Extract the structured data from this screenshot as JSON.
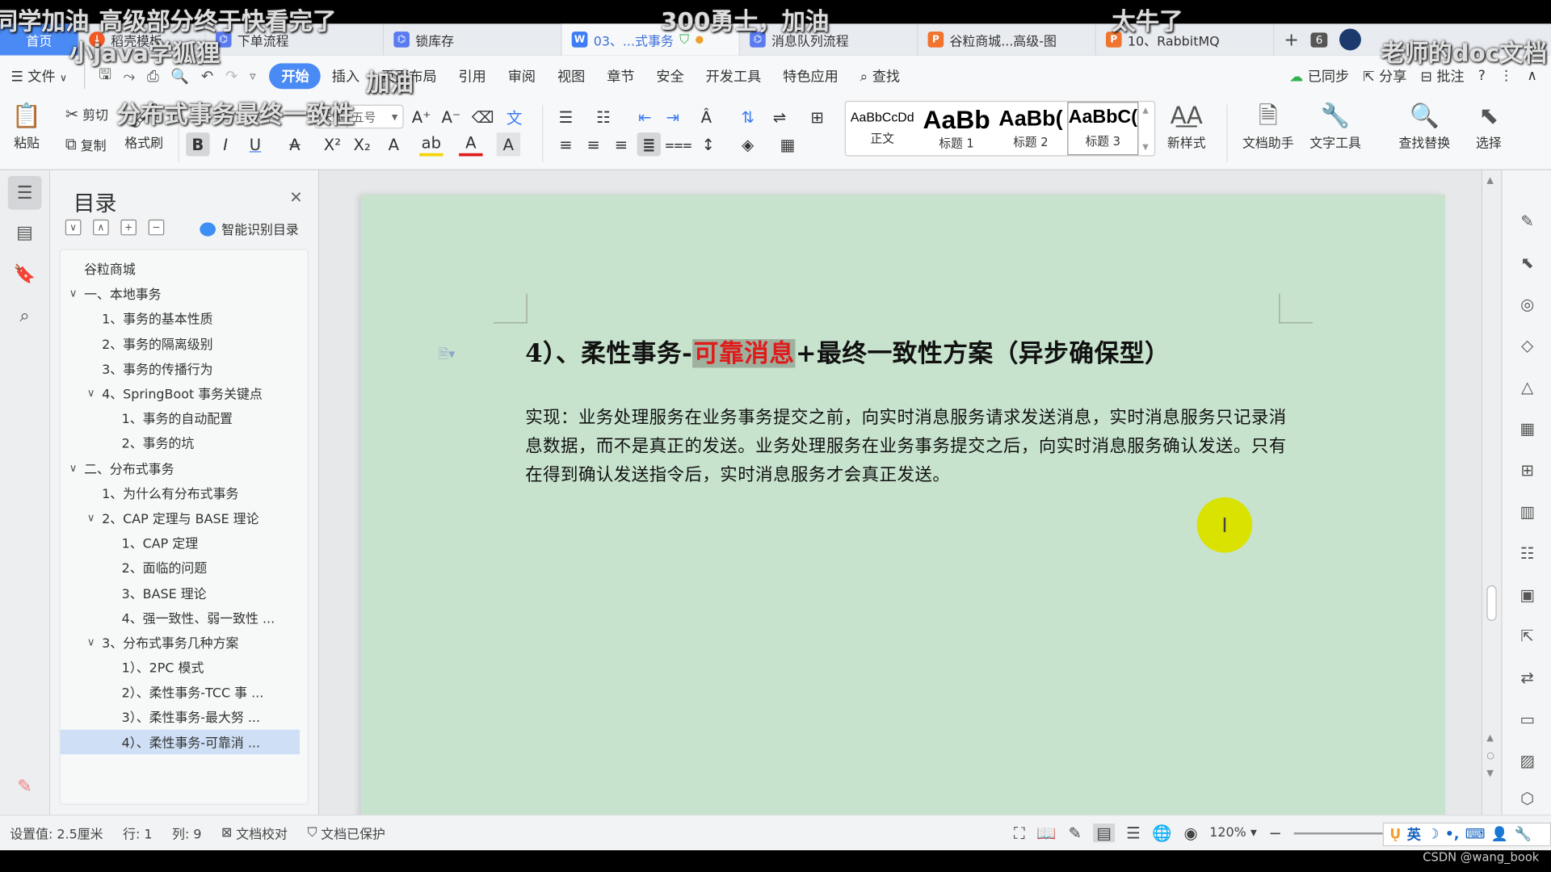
{
  "tabs": [
    {
      "label": "首页",
      "icon": "home",
      "kind": "home"
    },
    {
      "label": "稻壳模板",
      "icon": "daoke-icon",
      "kind": "daoke"
    },
    {
      "label": "下单流程",
      "icon": "flowchart-icon",
      "kind": "flow"
    },
    {
      "label": "锁库存",
      "icon": "flowchart-icon",
      "kind": "flow"
    },
    {
      "label": "03、...式事务",
      "icon": "word-doc-icon",
      "kind": "word",
      "active": true,
      "status": "●"
    },
    {
      "label": "消息队列流程",
      "icon": "flowchart-icon",
      "kind": "flow"
    },
    {
      "label": "谷粒商城...高级-图",
      "icon": "ppt-icon",
      "kind": "ppt"
    },
    {
      "label": "10、RabbitMQ",
      "icon": "ppt-icon",
      "kind": "ppt"
    }
  ],
  "tab_extras": {
    "new_tab": "+",
    "tab_count": "6"
  },
  "menu": {
    "file": "文件",
    "items": [
      "开始",
      "插入",
      "页面布局",
      "引用",
      "审阅",
      "视图",
      "章节",
      "安全",
      "开发工具",
      "特色应用"
    ],
    "active": "开始",
    "search": "查找",
    "right": {
      "sync": "已同步",
      "share": "分享",
      "comment": "批注"
    }
  },
  "ribbon": {
    "paste": "粘贴",
    "cut": "剪切",
    "copy": "复制",
    "format_painter": "格式刷",
    "font_name": "宋体(正文)",
    "font_size": "五号",
    "styles": [
      {
        "sample": "AaBbCcDd",
        "name": "正文"
      },
      {
        "sample": "AaBb",
        "name": "标题 1"
      },
      {
        "sample": "AaBb(",
        "name": "标题 2"
      },
      {
        "sample": "AaBbC(",
        "name": "标题 3",
        "selected": true
      }
    ],
    "new_style": "新样式",
    "doc_assistant": "文档助手",
    "text_tools": "文字工具",
    "find_replace": "查找替换",
    "select": "选择"
  },
  "toc": {
    "title": "目录",
    "smart_toc": "智能识别目录",
    "items": [
      {
        "label": "谷粒商城",
        "level": 0,
        "toggle": ""
      },
      {
        "label": "一、本地事务",
        "level": 0,
        "toggle": "∨"
      },
      {
        "label": "1、事务的基本性质",
        "level": 1,
        "toggle": ""
      },
      {
        "label": "2、事务的隔离级别",
        "level": 1,
        "toggle": ""
      },
      {
        "label": "3、事务的传播行为",
        "level": 1,
        "toggle": ""
      },
      {
        "label": "4、SpringBoot 事务关键点",
        "level": 1,
        "toggle": "∨"
      },
      {
        "label": "1、事务的自动配置",
        "level": 2,
        "toggle": ""
      },
      {
        "label": "2、事务的坑",
        "level": 2,
        "toggle": ""
      },
      {
        "label": "二、分布式事务",
        "level": 0,
        "toggle": "∨"
      },
      {
        "label": "1、为什么有分布式事务",
        "level": 1,
        "toggle": ""
      },
      {
        "label": "2、CAP 定理与 BASE 理论",
        "level": 1,
        "toggle": "∨"
      },
      {
        "label": "1、CAP 定理",
        "level": 2,
        "toggle": ""
      },
      {
        "label": "2、面临的问题",
        "level": 2,
        "toggle": ""
      },
      {
        "label": "3、BASE 理论",
        "level": 2,
        "toggle": ""
      },
      {
        "label": "4、强一致性、弱一致性 ...",
        "level": 2,
        "toggle": ""
      },
      {
        "label": "3、分布式事务几种方案",
        "level": 1,
        "toggle": "∨"
      },
      {
        "label": "1）、2PC 模式",
        "level": 2,
        "toggle": ""
      },
      {
        "label": "2）、柔性事务-TCC 事 ...",
        "level": 2,
        "toggle": ""
      },
      {
        "label": "3）、柔性事务-最大努 ...",
        "level": 2,
        "toggle": ""
      },
      {
        "label": "4）、柔性事务-可靠消 ...",
        "level": 2,
        "toggle": "",
        "selected": true
      }
    ]
  },
  "document": {
    "heading_pre": "4）、柔性事务-",
    "heading_highlight": "可靠消息",
    "heading_post": "+最终一致性方案（异步确保型）",
    "highlight_color": "#e01b1b",
    "body": "实现：业务处理服务在业务事务提交之前，向实时消息服务请求发送消息，实时消息服务只记录消息数据，而不是真正的发送。业务处理服务在业务事务提交之后，向实时消息服务确认发送。只有在得到确认发送指令后，实时消息服务才会真正发送。",
    "page_color": "#c7e3cd"
  },
  "statusbar": {
    "setting": "设置值: 2.5厘米",
    "row": "行: 1",
    "col": "列: 9",
    "proofread": "文档校对",
    "protection": "文档已保护",
    "zoom": "120%",
    "ime_lang": "英"
  },
  "danmaku": [
    "同学加油",
    "高级部分终于快看完了",
    "300勇士，加油",
    "太牛了",
    "小java学狐狸",
    "老师的doc文档",
    "加油",
    "分布式事务最终一致性"
  ],
  "watermark": "CSDN @wang_book"
}
